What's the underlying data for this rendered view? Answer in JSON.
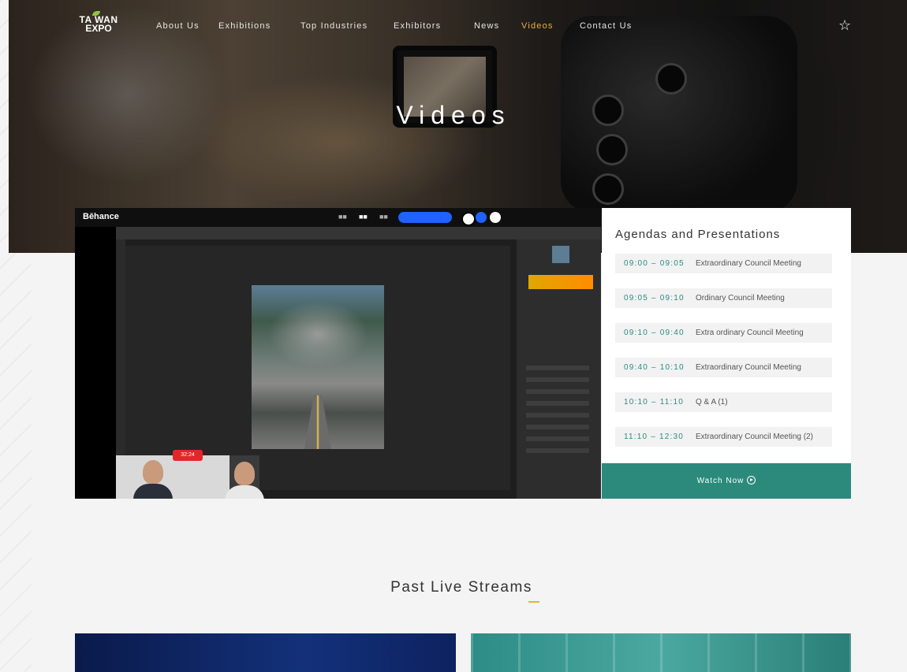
{
  "nav": {
    "logo_line1": "TA WAN",
    "logo_line2": "EXPO",
    "items": [
      {
        "label": "About Us"
      },
      {
        "label": "Exhibitions"
      },
      {
        "label": "Top Industries"
      },
      {
        "label": "Exhibitors"
      },
      {
        "label": "News"
      },
      {
        "label": "Videos",
        "active": true
      },
      {
        "label": "Contact Us"
      }
    ],
    "star_icon": "star-outline-icon"
  },
  "hero": {
    "title": "Videos"
  },
  "player": {
    "brand": "Bēhance",
    "timer": "32:24"
  },
  "agenda": {
    "title": "Agendas and Presentations",
    "items": [
      {
        "time": "09:00 – 09:05",
        "label": "Extraordinary Council Meeting"
      },
      {
        "time": "09:05 – 09:10",
        "label": "Ordinary Council Meeting"
      },
      {
        "time": "09:10 – 09:40",
        "label": "Extra ordinary Council Meeting"
      },
      {
        "time": "09:40 – 10:10",
        "label": "Extraordinary Council Meeting"
      },
      {
        "time": "10:10 – 11:10",
        "label": "Q & A (1)"
      },
      {
        "time": "11:10 – 12:30",
        "label": "Extraordinary Council Meeting (2)"
      }
    ],
    "watch_label": "Watch Now"
  },
  "past": {
    "title": "Past Live Streams"
  },
  "colors": {
    "accent": "#e4b23a",
    "teal": "#2b8a7c"
  }
}
